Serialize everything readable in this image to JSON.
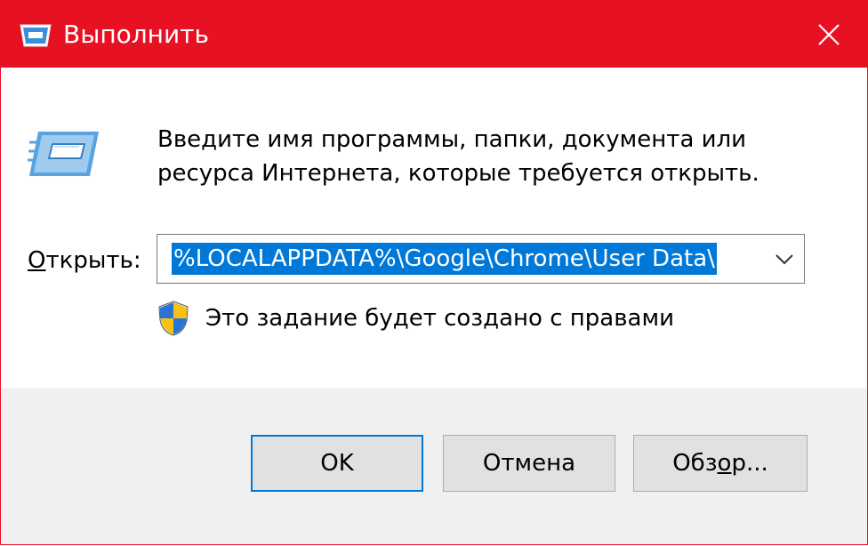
{
  "window": {
    "title": "Выполнить",
    "accent_color": "#e81123",
    "icons": {
      "app": "run-dialog-icon",
      "close": "close-icon"
    }
  },
  "main": {
    "icon": "run-program-icon",
    "description_lines": [
      "Введите имя программы, папки, документа или",
      "ресурса Интернета, которые требуется открыть."
    ],
    "open_label_prefix": "О",
    "open_label_rest": "ткрыть:",
    "open_value": "%LOCALAPPDATA%\\Google\\Chrome\\User Data\\",
    "selection_color": "#0078d7",
    "dropdown_icon": "chevron-down-icon",
    "admin_icon": "uac-shield-icon",
    "admin_note": "Это задание будет создано с правами"
  },
  "buttons": {
    "ok": "OK",
    "cancel": "Отмена",
    "browse_prefix": "Обз",
    "browse_underlined": "о",
    "browse_suffix": "р..."
  }
}
